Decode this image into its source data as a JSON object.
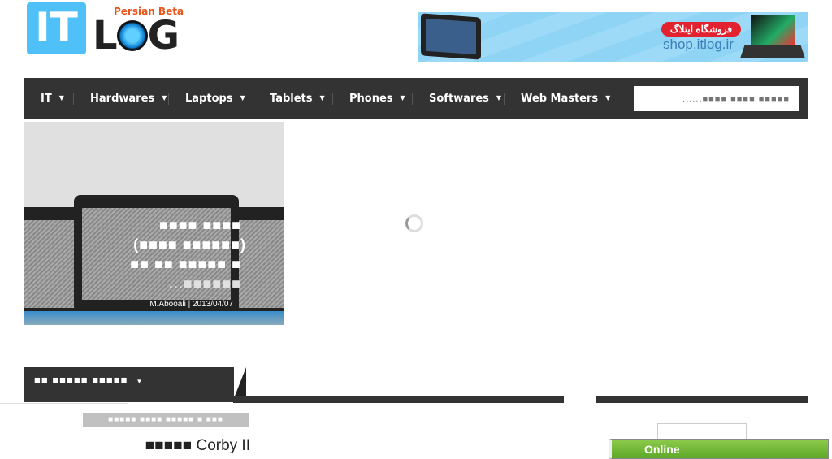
{
  "header": {
    "logo": {
      "it": "IT",
      "log_l": "L",
      "log_g": "G",
      "tagline": "Persian Beta"
    },
    "banner": {
      "shop_name": "فروشگاه ایتلاگ",
      "shop_url": "shop.itlog.ir"
    }
  },
  "nav": {
    "items": [
      {
        "label": "IT"
      },
      {
        "label": "Hardwares"
      },
      {
        "label": "Laptops"
      },
      {
        "label": "Tablets"
      },
      {
        "label": "Phones"
      },
      {
        "label": "Softwares"
      },
      {
        "label": "Web Masters"
      }
    ],
    "search_placeholder": "......■■■■ ■■■■ ■■■■■"
  },
  "slider": {
    "caption_lines": [
      "■■■■ ■■■■",
      "(■■■■ ■■■■■■)",
      "■■ ■■ ■■■■■ ■",
      "...■■■■■■"
    ],
    "author_date": "M.Abooali | 2013/04/07"
  },
  "section": {
    "tab_label": "■■ ■■■■■ ■■■■■",
    "subtitle": "■■■■■ ■■■■ ■■■■■ ■ ■■■",
    "post_title_prefix": "■■■■■",
    "post_title": "Corby II"
  },
  "online": {
    "label": "Online",
    "color": "#6fb83a"
  }
}
